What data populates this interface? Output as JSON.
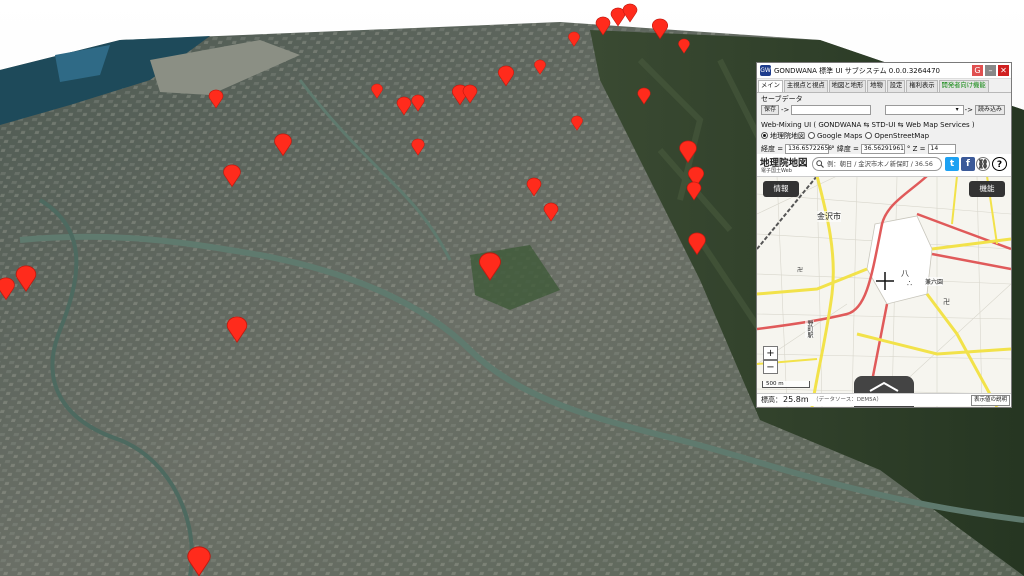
{
  "window": {
    "icon_text": "GW",
    "title": "GONDWANA 標準 UI サブシステム 0.0.0.3264470",
    "btn_menu": "G",
    "btn_minimize": "–",
    "btn_close": "✕",
    "btn_menu_color": "#e05050",
    "btn_min_color": "#888888",
    "btn_close_color": "#d02020"
  },
  "tabs": [
    {
      "label": "メイン",
      "active": true
    },
    {
      "label": "主視点と視点",
      "active": false
    },
    {
      "label": "地図と地形",
      "active": false
    },
    {
      "label": "地物",
      "active": false
    },
    {
      "label": "設定",
      "active": false
    },
    {
      "label": "権利表示",
      "active": false
    },
    {
      "label": "開発者向け機能",
      "active": false
    }
  ],
  "savedata": {
    "label": "セーブデータ",
    "save_button": "保存",
    "arrow": "->",
    "name_value": "",
    "select_value": "",
    "arrow2": "->",
    "load_button": "読み込み"
  },
  "mixing": {
    "label": "Web-Mixing UI ( GONDWANA ⇆ STD-UI ⇆ Web Map Services )",
    "options": [
      {
        "label": "地理院地図",
        "selected": true
      },
      {
        "label": "Google Maps",
        "selected": false
      },
      {
        "label": "OpenStreetMap",
        "selected": false
      }
    ]
  },
  "coords": {
    "lon_label": "経度 =",
    "lon_value": "136.65722656",
    "lat_label": "° 緯度 =",
    "lat_value": "36.56291961",
    "zoom_label": "° Z =",
    "zoom_value": "14"
  },
  "gsi": {
    "title": "地理院地図",
    "subtitle": "電子国土Web",
    "search_placeholder": "例：朝日 / 金沢市木ノ新保町 / 36.56",
    "twitter": "t",
    "facebook": "f",
    "link": "⛓",
    "help": "?",
    "info_button": "情報",
    "func_button": "機能",
    "city_label": "金沢市",
    "park_label": "兼六園",
    "station_label": "野町駅",
    "zoom_in": "+",
    "zoom_out": "−",
    "scale": "500 m",
    "elev_label": "標高：",
    "elev_value": "25.8m",
    "elev_source": "（データソース：DEM5A）",
    "legend_button": "表示値の説明"
  },
  "colors": {
    "marker": "#ff2b1c",
    "twitter": "#1da1f2",
    "facebook": "#3b5998",
    "dev_tab": "#118811",
    "road_yellow": "#f2e24a",
    "road_red": "#e05a5a"
  },
  "markers": [
    {
      "name": "marker-nw-1"
    },
    {
      "name": "marker-nw-2"
    },
    {
      "name": "marker-n-1"
    },
    {
      "name": "marker-n-2"
    },
    {
      "name": "marker-n-3"
    },
    {
      "name": "marker-n-4"
    },
    {
      "name": "marker-ne-1"
    },
    {
      "name": "marker-ne-2"
    },
    {
      "name": "marker-ne-3"
    },
    {
      "name": "marker-ne-4"
    },
    {
      "name": "marker-ne-5"
    },
    {
      "name": "marker-ne-6"
    },
    {
      "name": "marker-ne-7"
    },
    {
      "name": "marker-ne-8"
    },
    {
      "name": "marker-c-1"
    },
    {
      "name": "marker-c-2"
    },
    {
      "name": "marker-c-3"
    },
    {
      "name": "marker-c-4"
    },
    {
      "name": "marker-c-5"
    },
    {
      "name": "marker-w-1"
    },
    {
      "name": "marker-w-2"
    },
    {
      "name": "marker-w-3"
    },
    {
      "name": "marker-s-1"
    },
    {
      "name": "marker-s-2"
    },
    {
      "name": "marker-e-1"
    },
    {
      "name": "marker-e-2"
    },
    {
      "name": "marker-e-3"
    },
    {
      "name": "marker-e-4"
    },
    {
      "name": "marker-e-5"
    },
    {
      "name": "marker-e-6"
    }
  ]
}
